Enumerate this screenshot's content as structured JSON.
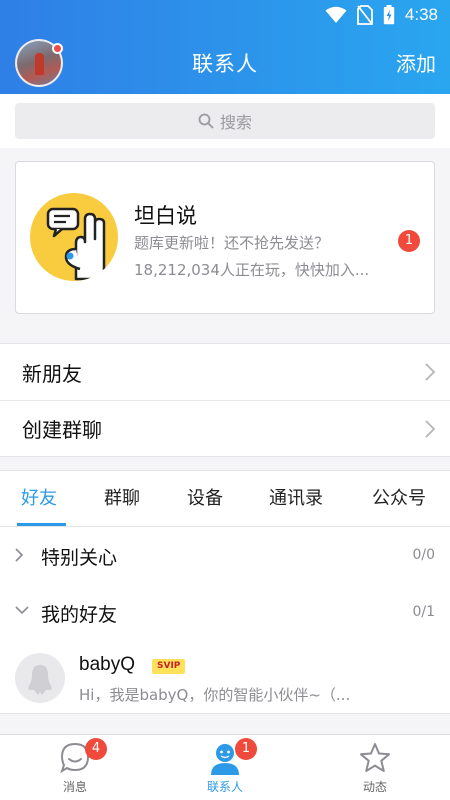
{
  "status_bar": {
    "time": "4:38"
  },
  "header": {
    "title": "联系人",
    "add_label": "添加"
  },
  "search": {
    "placeholder": "搜索"
  },
  "promo_card": {
    "title": "坦白说",
    "subtitle": "题库更新啦！还不抢先发送？",
    "players": "18,212,034人正在玩，快快加入...",
    "badge": "1"
  },
  "menu": {
    "new_friends": "新朋友",
    "create_group": "创建群聊"
  },
  "tabs": [
    {
      "label": "好友",
      "active": true
    },
    {
      "label": "群聊",
      "active": false
    },
    {
      "label": "设备",
      "active": false
    },
    {
      "label": "通讯录",
      "active": false
    },
    {
      "label": "公众号",
      "active": false
    }
  ],
  "groups": {
    "special": {
      "name": "特别关心",
      "count": "0/0",
      "expanded": false
    },
    "friends": {
      "name": "我的好友",
      "count": "0/1",
      "expanded": true
    }
  },
  "friend": {
    "name": "babyQ",
    "badge": "SVIP",
    "message": "Hi，我是babyQ，你的智能小伙伴~（..."
  },
  "bottom_nav": [
    {
      "label": "消息",
      "icon": "chat-icon",
      "badge": "4",
      "active": false
    },
    {
      "label": "联系人",
      "icon": "contacts-icon",
      "badge": "1",
      "active": true
    },
    {
      "label": "动态",
      "icon": "star-icon",
      "badge": null,
      "active": false
    }
  ],
  "colors": {
    "accent": "#2d9ae8",
    "header_start": "#2f7fe6",
    "header_end": "#2aa6ef",
    "badge": "#f04a3c"
  }
}
